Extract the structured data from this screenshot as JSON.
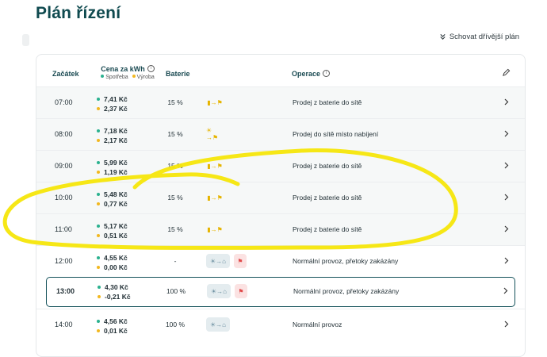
{
  "page": {
    "title": "Plán řízení",
    "hide_earlier": "Schovat dřívější plán"
  },
  "table": {
    "col_start": "Začátek",
    "col_price": "Cena za kWh",
    "legend_consumption": "Spotřeba",
    "legend_production": "Výroba",
    "col_battery": "Baterie",
    "col_operation": "Operace"
  },
  "rows": [
    {
      "time": "07:00",
      "buy": "7,41 Kč",
      "sell": "2,37 Kč",
      "battery": "15 %",
      "operation": "Prodej z baterie do sítě"
    },
    {
      "time": "08:00",
      "buy": "7,18 Kč",
      "sell": "2,17 Kč",
      "battery": "15 %",
      "operation": "Prodej do sítě místo nabíjení"
    },
    {
      "time": "09:00",
      "buy": "5,99 Kč",
      "sell": "1,19 Kč",
      "battery": "15 %",
      "operation": "Prodej z baterie do sítě"
    },
    {
      "time": "10:00",
      "buy": "5,48 Kč",
      "sell": "0,77 Kč",
      "battery": "15 %",
      "operation": "Prodej z baterie do sítě"
    },
    {
      "time": "11:00",
      "buy": "5,17 Kč",
      "sell": "0,51 Kč",
      "battery": "15 %",
      "operation": "Prodej z baterie do sítě"
    },
    {
      "time": "12:00",
      "buy": "4,55 Kč",
      "sell": "0,00 Kč",
      "battery": "-",
      "operation": "Normální provoz, přetoky zakázány"
    },
    {
      "time": "13:00",
      "buy": "4,30 Kč",
      "sell": "-0,21 Kč",
      "battery": "100 %",
      "operation": "Normální provoz, přetoky zakázány"
    },
    {
      "time": "14:00",
      "buy": "4,56 Kč",
      "sell": "0,01 Kč",
      "battery": "100 %",
      "operation": "Normální provoz"
    }
  ],
  "colors": {
    "title": "#0f4a4f",
    "consumption": "#2bb18f",
    "production": "#f2b820",
    "highlight": "#f5e60a",
    "current_border": "#14525a"
  },
  "icons": [
    "chevron-double-down-icon",
    "info-icon",
    "pencil-icon",
    "battery-to-grid-icon",
    "solar-to-grid-icon",
    "solar-to-home-icon",
    "grid-blocked-icon",
    "chevron-right-icon"
  ]
}
